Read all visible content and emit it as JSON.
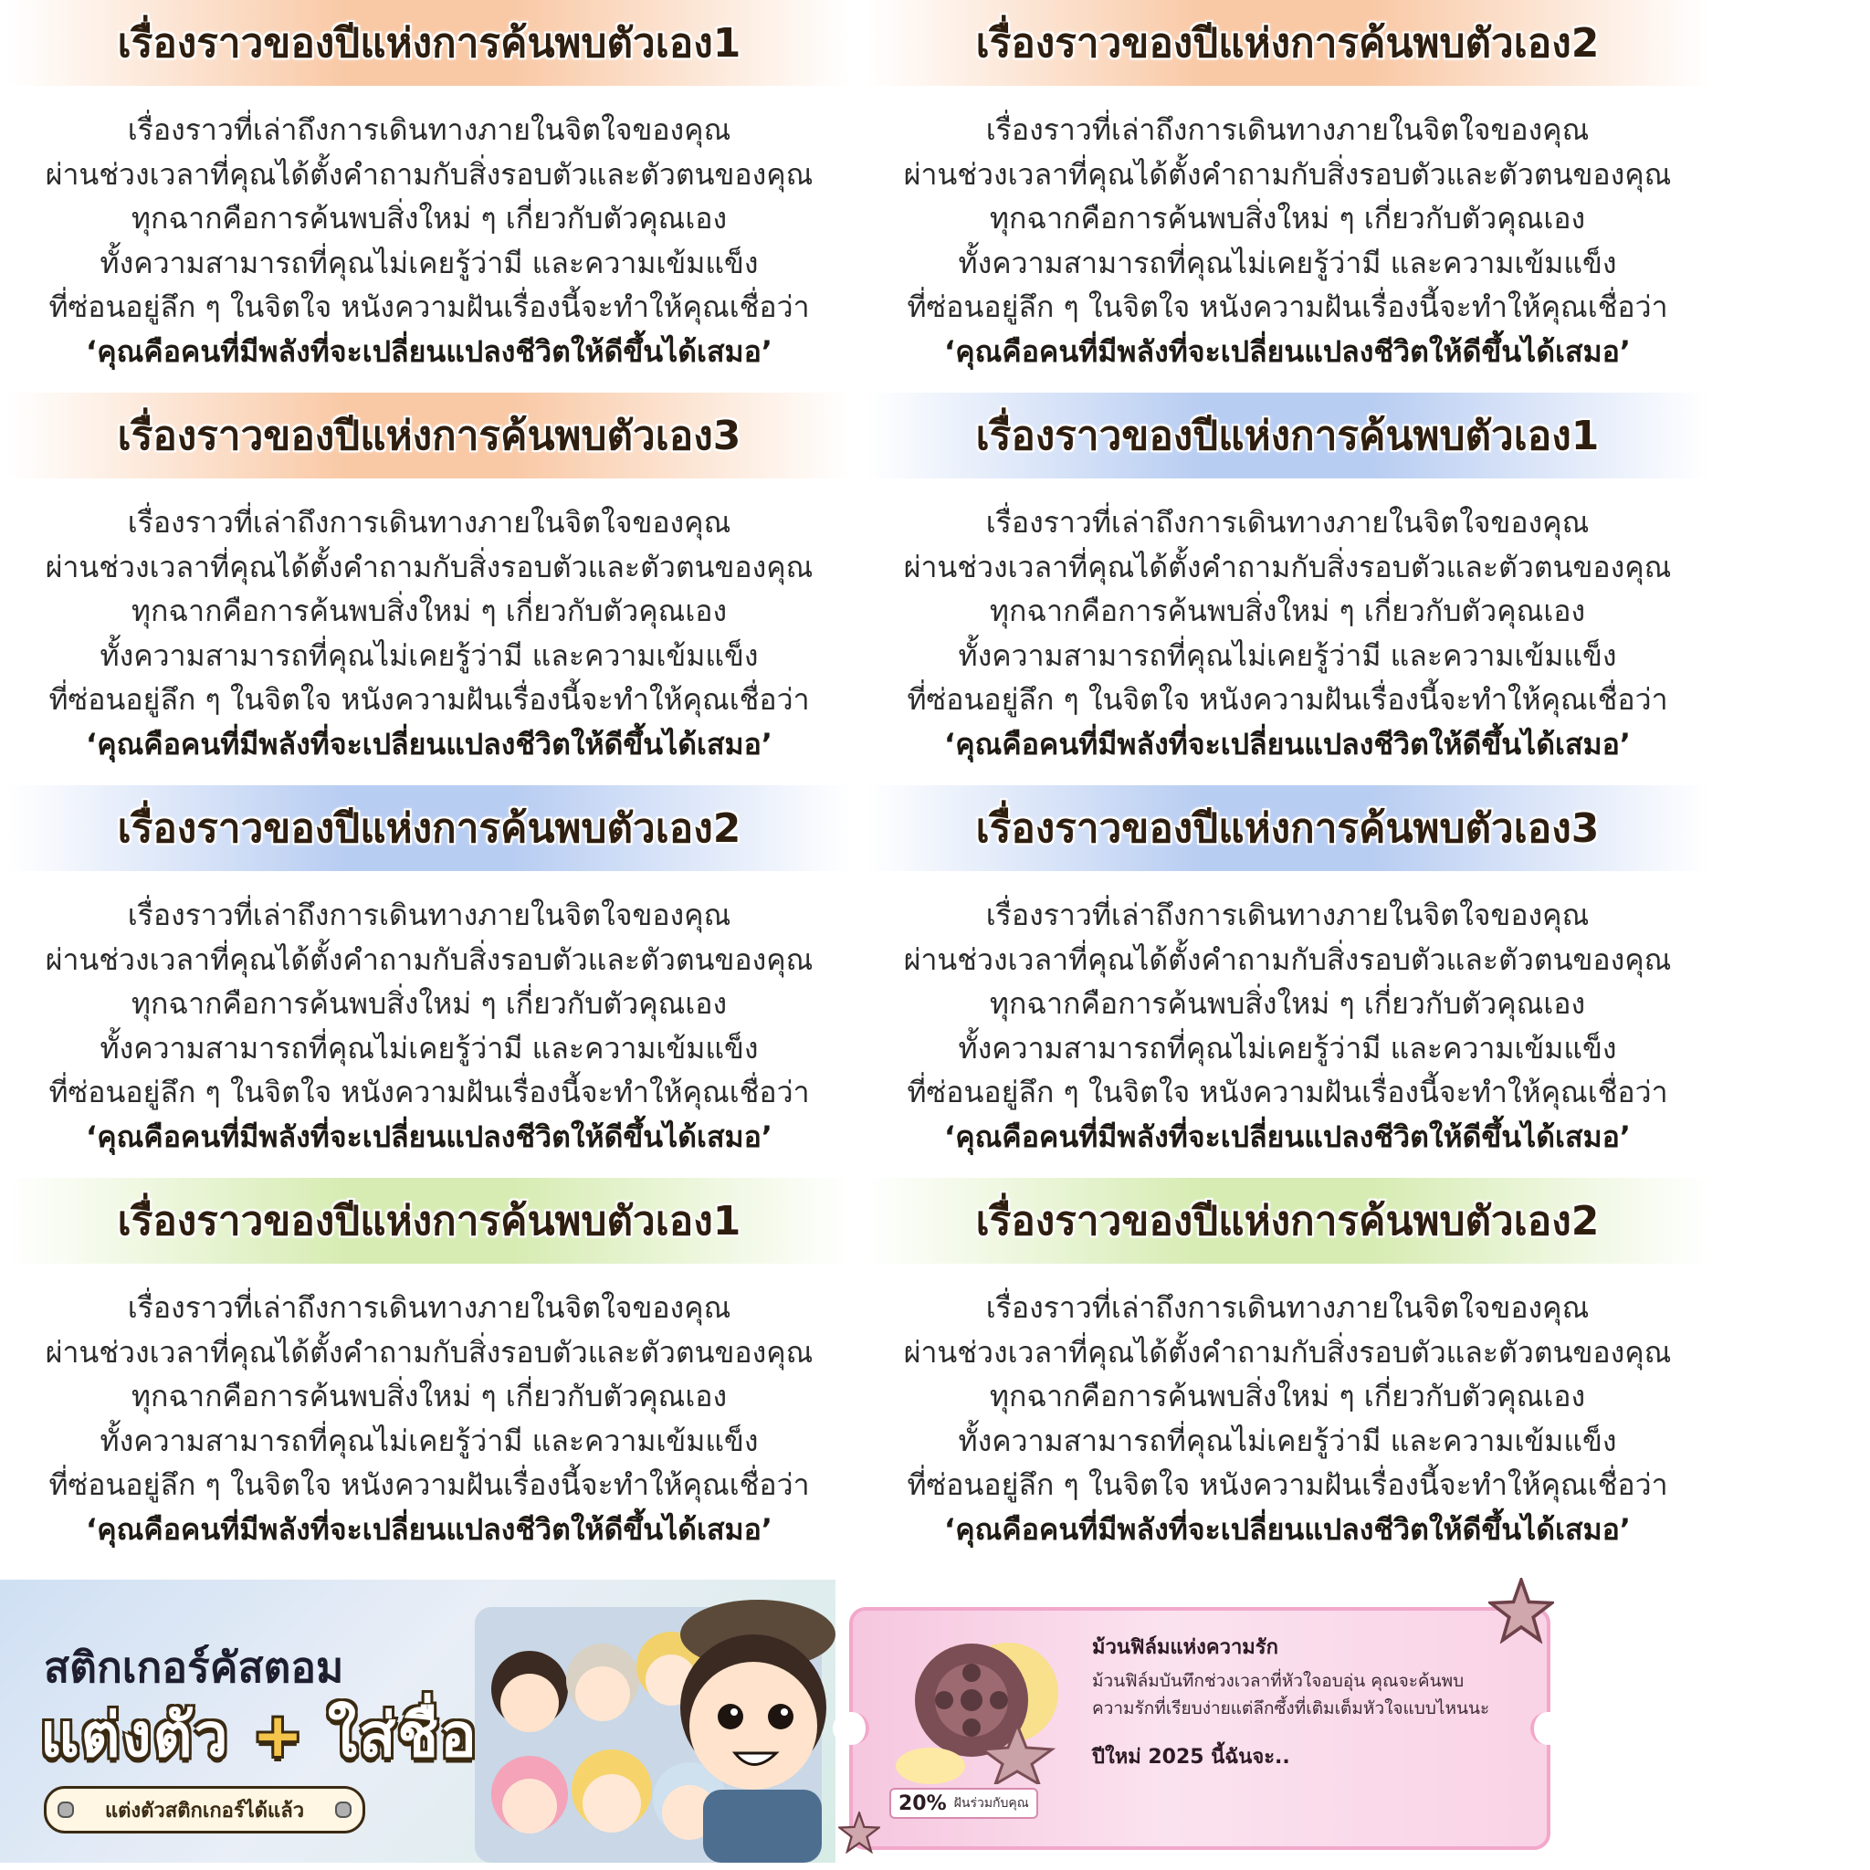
{
  "cards": [
    {
      "title": "เรื่องราวของปีแห่งการค้นพบตัวเอง1",
      "theme": "orange"
    },
    {
      "title": "เรื่องราวของปีแห่งการค้นพบตัวเอง2",
      "theme": "orange"
    },
    {
      "title": "เรื่องราวของปีแห่งการค้นพบตัวเอง3",
      "theme": "orange"
    },
    {
      "title": "เรื่องราวของปีแห่งการค้นพบตัวเอง1",
      "theme": "blue"
    },
    {
      "title": "เรื่องราวของปีแห่งการค้นพบตัวเอง2",
      "theme": "blue"
    },
    {
      "title": "เรื่องราวของปีแห่งการค้นพบตัวเอง3",
      "theme": "blue"
    },
    {
      "title": "เรื่องราวของปีแห่งการค้นพบตัวเอง1",
      "theme": "green"
    },
    {
      "title": "เรื่องราวของปีแห่งการค้นพบตัวเอง2",
      "theme": "green"
    }
  ],
  "card_body": {
    "line1": "เรื่องราวที่เล่าถึงการเดินทางภายในจิตใจของคุณ",
    "line2": "ผ่านช่วงเวลาที่คุณได้ตั้งคำถามกับสิ่งรอบตัวและตัวตนของคุณ",
    "line3": "ทุกฉากคือการค้นพบสิ่งใหม่ ๆ เกี่ยวกับตัวคุณเอง",
    "line4": "ทั้งความสามารถที่คุณไม่เคยรู้ว่ามี และความเข้มแข็ง",
    "line5": "ที่ซ่อนอยู่ลึก ๆ ในจิตใจ หนังความฝันเรื่องนี้จะทำให้คุณเชื่อว่า",
    "line6": "‘คุณคือคนที่มีพลังที่จะเปลี่ยนแปลงชีวิตให้ดีขึ้นได้เสมอ’"
  },
  "theme_colors": {
    "orange": "#f9c9a6",
    "blue": "#b8cdf2",
    "green": "#d7ecb3"
  },
  "sticker_banner": {
    "title": "สติกเกอร์คัสตอม",
    "big_part1": "แต่งตัว",
    "big_plus": "+",
    "big_part2": "ใส่ชื่อ",
    "button_label": "แต่งตัวสติกเกอร์ได้แล้ว"
  },
  "film_ticket": {
    "title": "ม้วนฟิล์มแห่งความรัก",
    "desc_line1": "ม้วนฟิล์มบันทึกช่วงเวลาที่หัวใจอบอุ่น คุณจะค้นพบ",
    "desc_line2": "ความรักที่เรียบง่ายแต่ลึกซึ้งที่เติมเต็มหัวใจแบบไหนนะ",
    "year_line": "ปีใหม่ 2025 นี้ฉันจะ..",
    "badge_percent": "20%",
    "badge_text": "ฝันร่วมกับคุณ"
  }
}
